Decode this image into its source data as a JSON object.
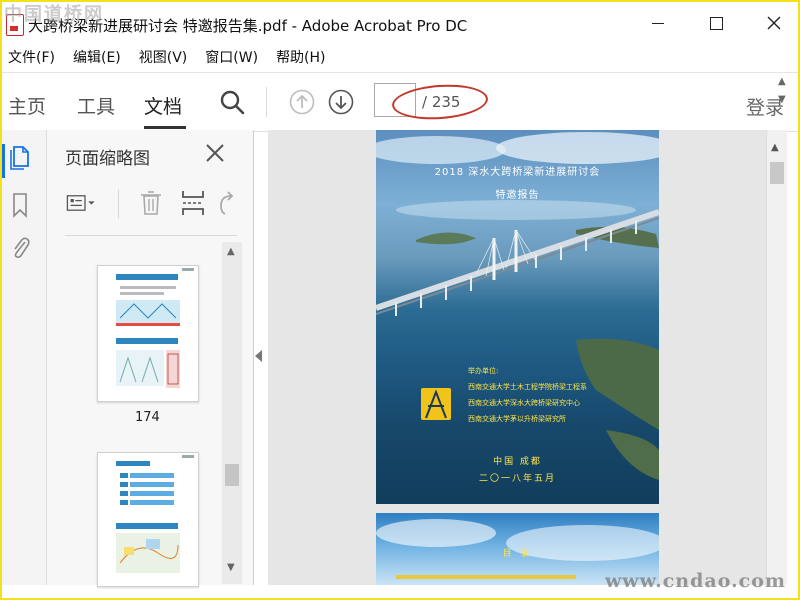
{
  "window": {
    "title": "大跨桥梁新进展研讨会 特邀报告集.pdf - Adobe Acrobat Pro DC",
    "watermark_top": "中国道桥网",
    "watermark_bottom": "www.cndao.com"
  },
  "menu": [
    "文件(F)",
    "编辑(E)",
    "视图(V)",
    "窗口(W)",
    "帮助(H)"
  ],
  "toolbar": {
    "tabs": [
      "主页",
      "工具",
      "文档"
    ],
    "active_tab": "文档",
    "page_input_value": "",
    "page_total": "/ 235",
    "login_label": "登录"
  },
  "left_strip": {
    "icons": [
      "page-thumbnails-icon",
      "bookmark-icon",
      "attachment-icon"
    ]
  },
  "thumbnail_panel": {
    "title": "页面缩略图",
    "thumbnails": [
      {
        "label": "174"
      },
      {
        "label": ""
      }
    ]
  },
  "document": {
    "cover": {
      "title": "2018 深水大跨桥梁新进展研讨会",
      "subtitle": "特邀报告",
      "organizers_label": "举办单位:",
      "organizers": [
        "西南交通大学土木工程学院桥梁工程系",
        "西南交通大学深水大跨桥梁研究中心",
        "西南交通大学茅以升桥梁研究所"
      ],
      "location": "中国 成都",
      "date": "二〇一八年五月"
    },
    "next_page_heading": "目 录"
  },
  "colors": {
    "accent_blue": "#1473e6",
    "annotation_red": "#c0392b",
    "cover_text_yellow": "#ffe54a"
  }
}
